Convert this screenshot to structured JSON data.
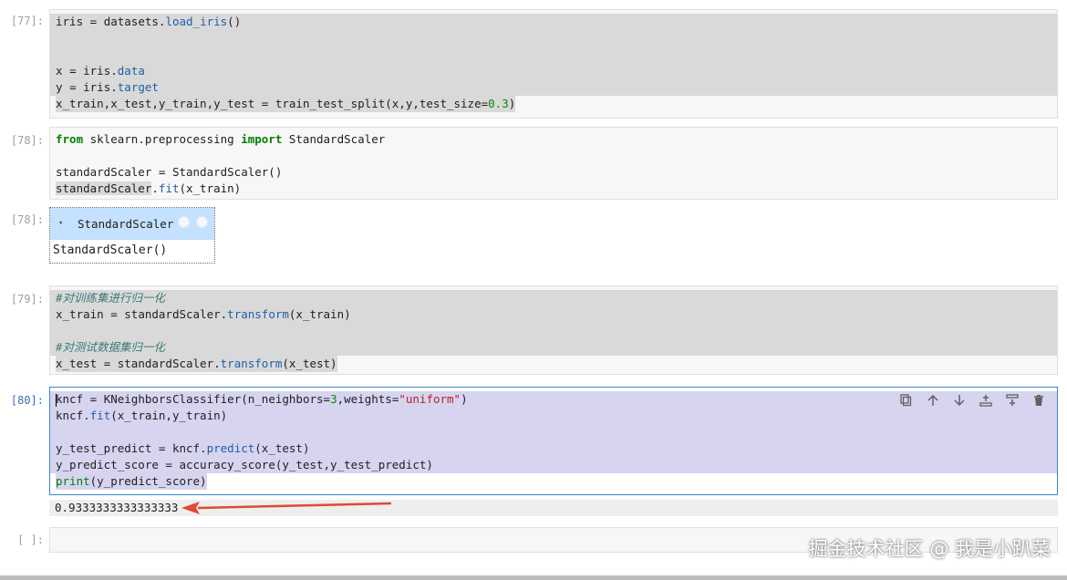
{
  "cells": {
    "c77": {
      "prompt": "[77]:",
      "lines": [
        [
          "iris ",
          "= ",
          "datasets.",
          "load_iris",
          "()"
        ],
        [
          "x ",
          "= ",
          "iris.",
          "data"
        ],
        [
          "y ",
          "= ",
          "iris.",
          "target"
        ],
        [
          "x_train,x_test,y_train,y_test ",
          "= ",
          "train_test_split(x,y,test_size",
          "=",
          "0.3",
          ")"
        ]
      ]
    },
    "c78": {
      "prompt": "[78]:",
      "lines": [
        [
          "from",
          " sklearn.preprocessing ",
          "import",
          " StandardScaler"
        ],
        [
          "standardScaler ",
          "= ",
          "StandardScaler()"
        ],
        [
          "standardScaler",
          ".",
          "fit",
          "(x_train)"
        ]
      ]
    },
    "c78out": {
      "prompt": "[78]:",
      "header_label": "StandardScaler",
      "arrow": "▾",
      "body": "StandardScaler()"
    },
    "c79": {
      "prompt": "[79]:",
      "lines": [
        [
          "#对训练集进行归一化"
        ],
        [
          "x_train ",
          "= ",
          "standardScaler.",
          "transform",
          "(x_train)"
        ],
        [
          "#对测试数据集归一化"
        ],
        [
          "x_test ",
          "= ",
          "standardScaler.",
          "transform",
          "(x_test)"
        ]
      ]
    },
    "c80": {
      "prompt": "[80]:",
      "lines": [
        [
          "kncf ",
          "= ",
          "KNeighborsClassifier(n_neighbors",
          "=",
          "3",
          ",weights",
          "=",
          "\"uniform\"",
          ")"
        ],
        [
          "kncf.",
          "fit",
          "(x_train,y_train)"
        ],
        [
          "y_test_predict ",
          "= ",
          "kncf.",
          "predict",
          "(x_test)"
        ],
        [
          "y_predict_score ",
          "= ",
          "accuracy_score(y_test,y_test_predict)"
        ],
        [
          "print",
          "(y_predict_score)"
        ]
      ],
      "output": "0.9333333333333333",
      "toolbar": [
        "duplicate-icon",
        "move-up-icon",
        "move-down-icon",
        "insert-above-icon",
        "insert-below-icon",
        "delete-icon"
      ]
    },
    "empty": {
      "prompt": "[ ]:"
    }
  },
  "watermark": "掘金技术社区 @ 我是小趴菜",
  "colors": {
    "keyword": "#008000",
    "function": "#1f5fa8",
    "number": "#0a8a0a",
    "string": "#ba2121",
    "comment": "#3d7a7a",
    "active_border": "#3a86c8",
    "arrow": "#e04a32"
  }
}
